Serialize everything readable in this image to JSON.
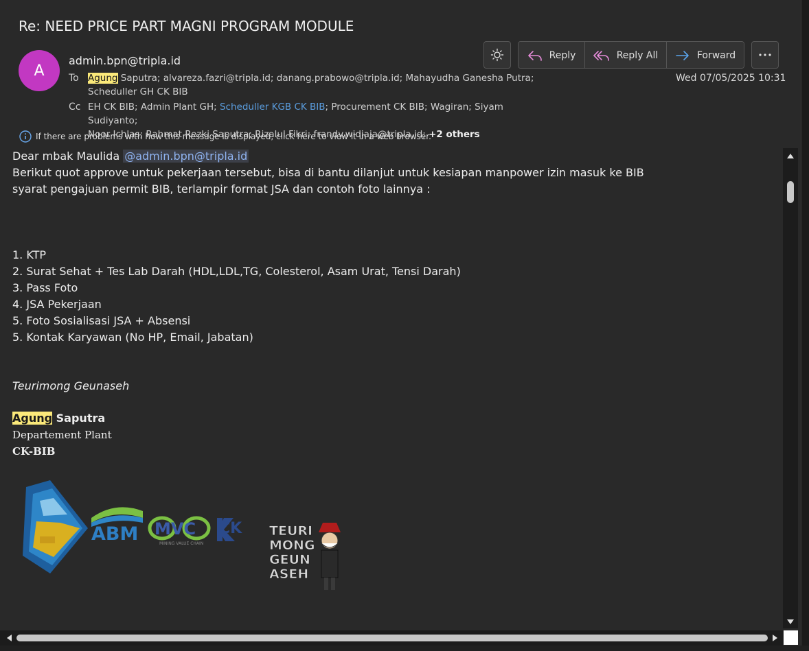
{
  "email": {
    "subject": "Re: NEED PRICE PART MAGNI PROGRAM MODULE",
    "avatar_initial": "A",
    "avatar_color": "#c238c2",
    "from": "admin.bpn@tripla.id",
    "to_label": "To",
    "to_line1_hl": "Agung",
    "to_line1_rest": " Saputra; alvareza.fazri@tripla.id; danang.prabowo@tripla.id; Mahayudha Ganesha Putra;",
    "to_line2": "Scheduller GH CK BIB",
    "cc_label": "Cc",
    "cc_line1_a": "EH CK BIB; Admin Plant GH; ",
    "cc_line1_link": "Scheduller KGB CK BIB",
    "cc_line1_b": "; Procurement CK BIB; Wagiran; Siyam Sudiyanto;",
    "cc_line2": "Noor Ichlas; Rahmat Rezki Saputra; Rizalul Fikri; frandy.widjaja@tripla.id; ",
    "cc_more": "+2 others",
    "date": "Wed 07/05/2025 10:31",
    "info_bar": "If there are problems with how this message is displayed, click here to view it in a web browser."
  },
  "toolbar": {
    "reply": "Reply",
    "reply_all": "Reply All",
    "forward": "Forward"
  },
  "body": {
    "greeting": "Dear mbak Maulida ",
    "mention": "@admin.bpn@tripla.id",
    "line1": "Berikut quot approve untuk pekerjaan tersebut, bisa di bantu dilanjut untuk kesiapan manpower izin masuk ke BIB",
    "line2": "syarat pengajuan permit BIB, terlampir format JSA dan contoh foto lainnya :",
    "items": [
      "1. KTP",
      "2. Surat Sehat + Tes Lab Darah (HDL,LDL,TG, Colesterol, Asam Urat, Tensi Darah)",
      "3. Pass Foto",
      "4. JSA Pekerjaan",
      "5. Foto Sosialisasi JSA + Absensi",
      "5. Kontak Karyawan (No HP, Email, Jabatan)"
    ],
    "tagline": "Teurimong Geunaseh",
    "sig_name_hl": "Agung",
    "sig_name_rest": " Saputra",
    "sig_dept": "Departement Plant",
    "sig_site": "CK-BIB"
  },
  "logos": {
    "abm": "ABM",
    "mvc": "MVC",
    "mvc_sub": "MINING VALUE CHAIN",
    "ck": "CK",
    "mascot": [
      "TEURI",
      "MONG",
      "GEUN",
      "ASEH"
    ]
  }
}
